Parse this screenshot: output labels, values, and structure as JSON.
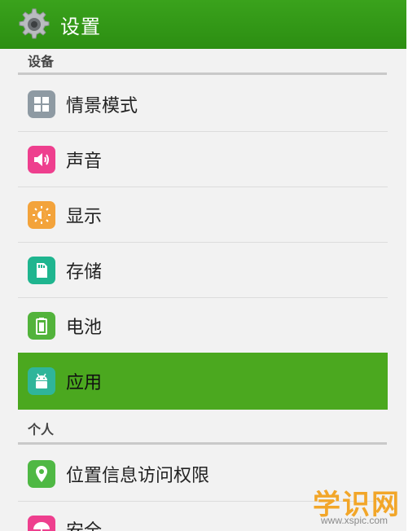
{
  "action_bar": {
    "title": "设置",
    "icon": "gear-icon"
  },
  "sections": [
    {
      "title": "设备",
      "items": [
        {
          "label": "情景模式",
          "icon": "profiles-grid-icon",
          "color": "#8e9aa3"
        },
        {
          "label": "声音",
          "icon": "speaker-icon",
          "color": "#ee3f8e"
        },
        {
          "label": "显示",
          "icon": "brightness-icon",
          "color": "#f3a33b"
        },
        {
          "label": "存储",
          "icon": "sd-card-icon",
          "color": "#1fb58f"
        },
        {
          "label": "电池",
          "icon": "battery-icon",
          "color": "#52b33b"
        },
        {
          "label": "应用",
          "icon": "android-icon",
          "color": "#2fb59a",
          "selected": true
        }
      ]
    },
    {
      "title": "个人",
      "items": [
        {
          "label": "位置信息访问权限",
          "icon": "location-pin-icon",
          "color": "#4fb844"
        },
        {
          "label": "安全",
          "icon": "umbrella-icon",
          "color": "#ee3f8e"
        }
      ]
    }
  ],
  "colors": {
    "action_bar": "#329a18",
    "selected_row": "#4ba81f"
  },
  "watermark": {
    "main": "学识网",
    "sub": "www.xspic.com"
  }
}
